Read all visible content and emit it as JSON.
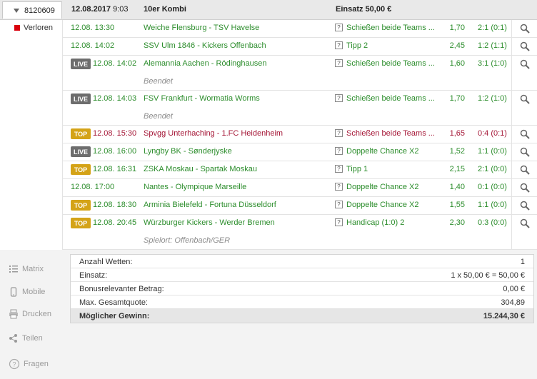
{
  "header": {
    "bet_id": "8120609",
    "date_bold": "12.08.2017",
    "time": "9:03",
    "bet_type": "10er Kombi",
    "stake_label": "Einsatz 50,00 €"
  },
  "status": {
    "label": "Verloren",
    "color": "#d9000d"
  },
  "rows": [
    {
      "badge": "",
      "time": "12.08. 13:30",
      "match": "Weiche Flensburg - TSV Havelse",
      "market": "Schießen beide Teams ...",
      "odds": "1,70",
      "result": "2:1 (0:1)",
      "sub": ""
    },
    {
      "badge": "",
      "time": "12.08. 14:02",
      "match": "SSV Ulm 1846 - Kickers Offenbach",
      "market": "Tipp 2",
      "odds": "2,45",
      "result": "1:2 (1:1)",
      "sub": ""
    },
    {
      "badge": "LIVE",
      "time": "12.08. 14:02",
      "match": "Alemannia Aachen - Rödinghausen",
      "market": "Schießen beide Teams ...",
      "odds": "1,60",
      "result": "3:1 (1:0)",
      "sub": "Beendet"
    },
    {
      "badge": "LIVE",
      "time": "12.08. 14:03",
      "match": "FSV Frankfurt - Wormatia Worms",
      "market": "Schießen beide Teams ...",
      "odds": "1,70",
      "result": "1:2 (1:0)",
      "sub": "Beendet"
    },
    {
      "badge": "TOP",
      "time": "12.08. 15:30",
      "match": "Spvgg Unterhaching - 1.FC Heidenheim",
      "market": "Schießen beide Teams ...",
      "odds": "1,65",
      "result": "0:4 (0:1)",
      "sub": "",
      "lost": true
    },
    {
      "badge": "LIVE",
      "time": "12.08. 16:00",
      "match": "Lyngby BK - Sønderjyske",
      "market": "Doppelte Chance X2",
      "odds": "1,52",
      "result": "1:1 (0:0)",
      "sub": ""
    },
    {
      "badge": "TOP",
      "time": "12.08. 16:31",
      "match": "ZSKA Moskau - Spartak Moskau",
      "market": "Tipp 1",
      "odds": "2,15",
      "result": "2:1 (0:0)",
      "sub": ""
    },
    {
      "badge": "",
      "time": "12.08. 17:00",
      "match": "Nantes - Olympique Marseille",
      "market": "Doppelte Chance X2",
      "odds": "1,40",
      "result": "0:1 (0:0)",
      "sub": ""
    },
    {
      "badge": "TOP",
      "time": "12.08. 18:30",
      "match": "Arminia Bielefeld - Fortuna Düsseldorf",
      "market": "Doppelte Chance X2",
      "odds": "1,55",
      "result": "1:1 (0:0)",
      "sub": ""
    },
    {
      "badge": "TOP",
      "time": "12.08. 20:45",
      "match": "Würzburger Kickers - Werder Bremen",
      "market": "Handicap (1:0) 2",
      "odds": "2,30",
      "result": "0:3 (0:0)",
      "sub": "Spielort: Offenbach/GER"
    }
  ],
  "menu": {
    "matrix": "Matrix",
    "mobile": "Mobile",
    "print": "Drucken",
    "share": "Teilen",
    "questions": "Fragen"
  },
  "summary": [
    {
      "label": "Anzahl Wetten:",
      "value": "1"
    },
    {
      "label": "Einsatz:",
      "value": "1 x 50,00 € = 50,00 €"
    },
    {
      "label": "Bonusrelevanter Betrag:",
      "value": "0,00 €"
    },
    {
      "label": "Max. Gesamtquote:",
      "value": "304,89"
    },
    {
      "label": "Möglicher Gewinn:",
      "value": "15.244,30 €"
    }
  ],
  "colors": {
    "win_green": "#2c8d2c",
    "lost_red": "#a51737",
    "live_badge": "#6d6d6d",
    "top_badge": "#d4a317"
  },
  "icons": [
    "dropdown-arrow-icon",
    "help-icon",
    "magnifier-icon",
    "matrix-icon",
    "mobile-icon",
    "printer-icon",
    "share-icon",
    "question-icon"
  ]
}
